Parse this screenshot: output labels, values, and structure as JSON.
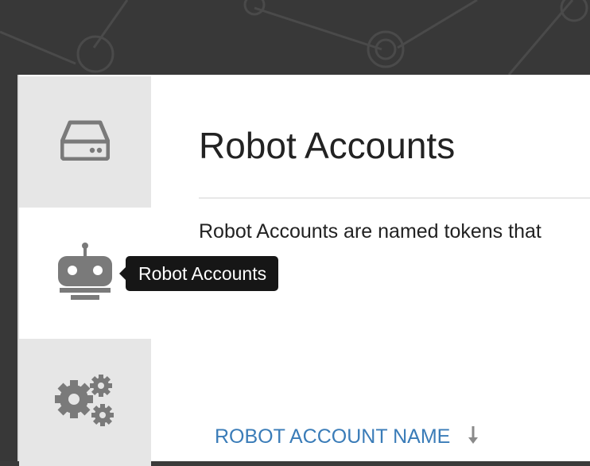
{
  "colors": {
    "backdrop": "#383838",
    "nav_inactive": "#e6e6e6",
    "icon_gray": "#7a7a7a",
    "tooltip_bg": "#161616",
    "link_blue": "#3a7cb8",
    "text_dark": "#222222"
  },
  "sidebar": {
    "items": [
      {
        "icon": "repository-drive-icon",
        "active": false
      },
      {
        "icon": "robot-icon",
        "active": true
      },
      {
        "icon": "gears-settings-icon",
        "active": false
      }
    ],
    "tooltip": "Robot Accounts"
  },
  "main": {
    "title": "Robot Accounts",
    "description": "Robot Accounts are named tokens that",
    "table": {
      "columns": [
        {
          "label": "ROBOT ACCOUNT NAME",
          "sort_icon": "sort-down-arrow-icon"
        }
      ]
    }
  }
}
